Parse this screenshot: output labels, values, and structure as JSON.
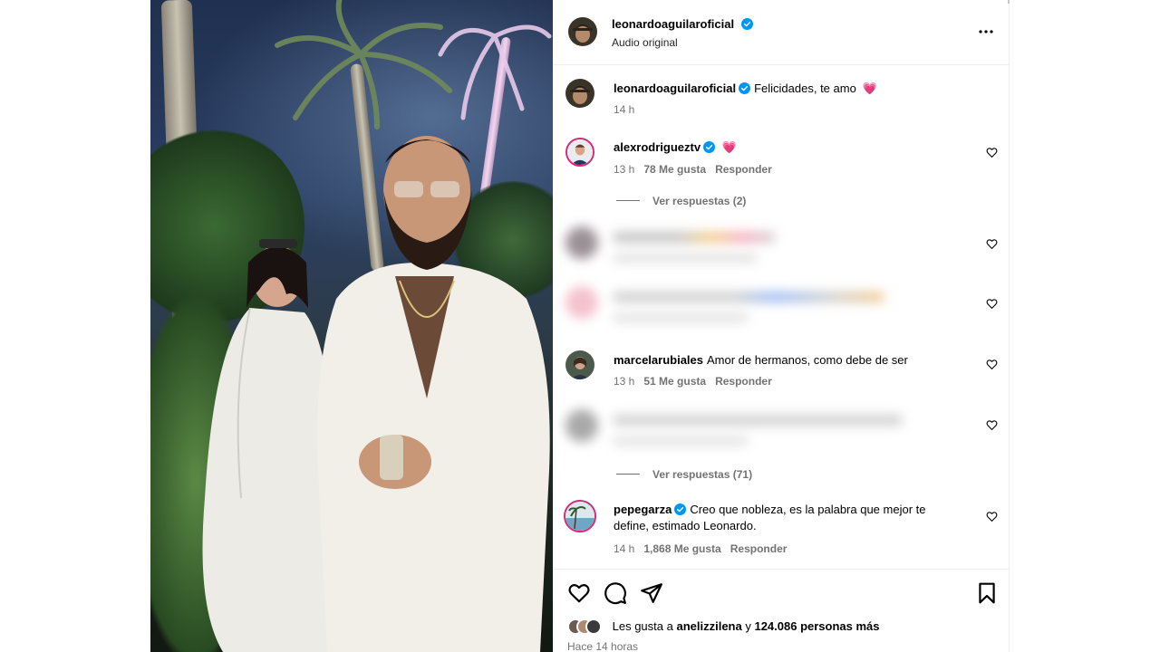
{
  "post": {
    "author": "leonardoaguilaroficial",
    "subtitle": "Audio original",
    "more_icon": "more-horizontal-icon",
    "caption": {
      "user": "leonardoaguilaroficial",
      "text": "Felicidades, te amo",
      "emoji": "💗",
      "time": "14 h"
    }
  },
  "comments": [
    {
      "user": "alexrodrigueztv",
      "text": "💗",
      "time": "13 h",
      "likes": "78 Me gusta",
      "reply": "Responder",
      "replies_label": "Ver respuestas (2)"
    },
    {
      "user": "marcelarubiales",
      "text": "Amor de hermanos, como debe de ser",
      "time": "13 h",
      "likes": "51 Me gusta",
      "reply": "Responder",
      "replies_label": "Ver respuestas (71)"
    },
    {
      "user": "pepegarza",
      "text": "Creo que nobleza, es la palabra que mejor te define, estimado Leonardo.",
      "time": "14 h",
      "likes": "1,868 Me gusta",
      "reply": "Responder"
    }
  ],
  "footer": {
    "likes_prefix": "Les gusta a",
    "likes_user": "anelizzilena",
    "likes_joiner": "y",
    "likes_count": "124.086 personas más",
    "time_ago": "Hace 14 horas"
  },
  "colors": {
    "verified": "#0095f6",
    "heart_emoji": "#e0245e",
    "meta_gray": "#737373"
  }
}
